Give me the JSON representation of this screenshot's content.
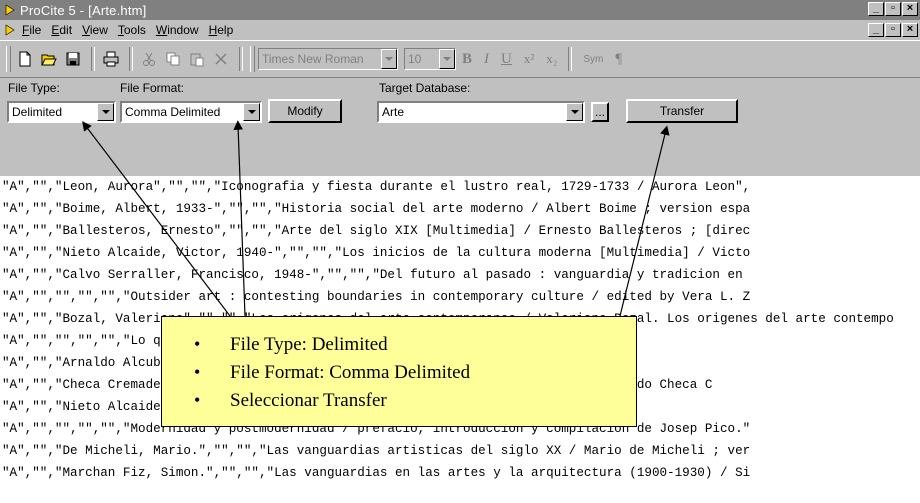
{
  "window": {
    "title": "ProCite 5 - [Arte.htm]"
  },
  "menu": [
    "File",
    "Edit",
    "View",
    "Tools",
    "Window",
    "Help"
  ],
  "menu_underline": [
    "F",
    "E",
    "V",
    "T",
    "W",
    "H"
  ],
  "toolbar": {
    "font_name": "Times New Roman",
    "font_size": "10",
    "bold": "B",
    "italic": "I",
    "underline": "U",
    "superscript": "x²",
    "subscript": "x₂",
    "symbol": "Sym",
    "pilcrow": "¶"
  },
  "controls": {
    "file_type_label": "File Type:",
    "file_type_value": "Delimited",
    "file_format_label": "File Format:",
    "file_format_value": "Comma Delimited",
    "modify_label": "Modify",
    "target_db_label": "Target Database:",
    "target_db_value": "Arte",
    "browse_label": "...",
    "transfer_label": "Transfer"
  },
  "records": [
    "\"A\",\"\",\"Leon, Aurora\",\"\",\"\",\"Iconografia y fiesta durante el lustro real, 1729-1733 / Aurora Leon\",",
    "\"A\",\"\",\"Boime, Albert, 1933-\",\"\",\"\",\"Historia social del arte moderno / Albert Boime ; version espa",
    "\"A\",\"\",\"Ballesteros, Ernesto\",\"\",\"\",\"Arte del siglo XIX [Multimedia] / Ernesto Ballesteros ; [direc",
    "\"A\",\"\",\"Nieto Alcaide, Victor, 1940-\",\"\",\"\",\"Los inicios de la cultura moderna [Multimedia] / Victo",
    "\"A\",\"\",\"Calvo Serraller, Francisco, 1948-\",\"\",\"\",\"Del futuro al pasado : vanguardia y tradicion en",
    "\"A\",\"\",\"\",\"\",\"\",\"Outsider art : contesting boundaries in contemporary culture / edited by Vera L. Z",
    "\"A\",\"\",\"Bozal, Valeriano\",\"\",\"\",\"Los origenes del arte contemporaneo / Valeriano Bozal. Los origenes del arte contempo",
    "\"A\",\"\",\"\",\"\",\"\",\"Lo que hay que ver : el arte posicionado : Pintura y e",
    "\"A\",\"\",\"Arnaldo Alcubilla, Javier\",\"\",\"\",\"Las artes / por Javier Arnaldo\",\"\",",
    "\"A\",\"\",\"Checa Cremades, Fernando\",\"\",\"\",\"Arte del Renacimiento [Multimedia] / Fernando Checa C",
    "\"A\",\"\",\"Nieto Alcaide, Victor\",\"\",\"\",\"La cultura moderna [Multimedia] / Victo",
    "\"A\",\"\",\"\",\"\",\"\",\"Modernidad y postmodernidad / prefacio, introduccion y compilacion de Josep Pico.\"",
    "\"A\",\"\",\"De Micheli, Mario.\",\"\",\"\",\"Las vanguardias artisticas del siglo XX / Mario de Micheli ; ver",
    "\"A\",\"\",\"Marchan Fiz, Simon.\",\"\",\"\",\"Las vanguardias en las artes y la arquitectura (1900-1930) / Si"
  ],
  "callout": {
    "items": [
      "File Type: Delimited",
      "File Format: Comma Delimited",
      "Seleccionar Transfer"
    ]
  },
  "colors": {
    "callout_bg": "#ffff99",
    "chrome": "#c0c0c0",
    "titlebar": "#808080"
  }
}
